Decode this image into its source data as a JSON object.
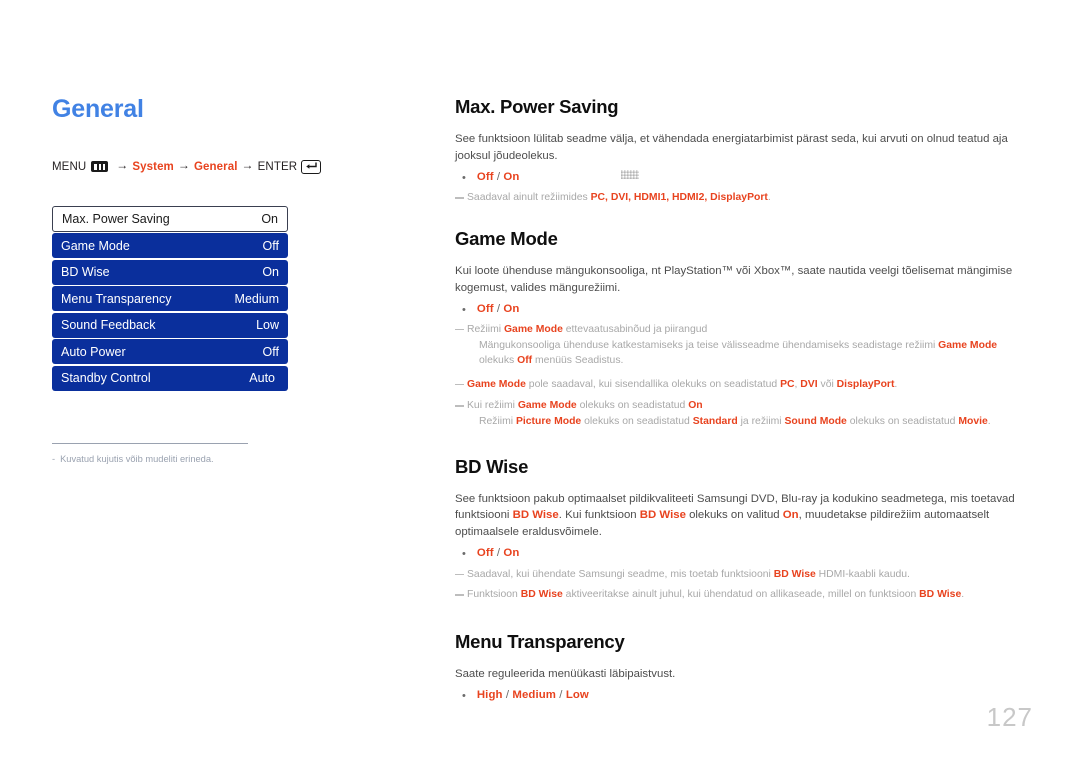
{
  "page": {
    "section_title": "General",
    "page_number": "127"
  },
  "breadcrumb": {
    "menu_label": "MENU",
    "menu_icon": "menu-bars-icon",
    "arrow": "→",
    "step1": "System",
    "step2": "General",
    "enter_label": "ENTER",
    "enter_icon": "enter-return-icon"
  },
  "osd_menu": {
    "rows": [
      {
        "label": "Max. Power Saving",
        "value": "On",
        "selected": true
      },
      {
        "label": "Game Mode",
        "value": "Off",
        "selected": false
      },
      {
        "label": "BD Wise",
        "value": "On",
        "selected": false
      },
      {
        "label": "Menu Transparency",
        "value": "Medium",
        "selected": false
      },
      {
        "label": "Sound Feedback",
        "value": "Low",
        "selected": false
      },
      {
        "label": "Auto Power",
        "value": "Off",
        "selected": false
      },
      {
        "label": "Standby Control",
        "value": "Auto",
        "selected": false
      }
    ]
  },
  "left_note": {
    "dash": "-",
    "text": "Kuvatud kujutis võib mudeliti erineda."
  },
  "topics": {
    "max_power_saving": {
      "title": "Max. Power Saving",
      "body": "See funktsioon lülitab seadme välja, et vähendada energiatarbimist pärast seda, kui arvuti on olnud teatud aja jooksul jõudeolekus.",
      "options": "Off / On",
      "note1_prefix": "Saadaval ainult režiimides ",
      "note1_modes": "PC, DVI, HDMI1, HDMI2, DisplayPort",
      "note1_suffix": "."
    },
    "game_mode": {
      "title": "Game Mode",
      "body": "Kui loote ühenduse mängukonsooliga, nt PlayStation™ või Xbox™, saate nautida veelgi tõelisemat mängimise kogemust, valides mängurežiimi.",
      "options": "Off / On",
      "note1_a": "Režiimi ",
      "note1_b": "Game Mode",
      "note1_c": " ettevaatusabinõud ja piirangud",
      "note1_sub_a": "Mängukonsooliga ühenduse katkestamiseks ja teise välisseadme ühendamiseks seadistage režiimi ",
      "note1_sub_b": "Game Mode",
      "note1_sub_c": " olekuks ",
      "note1_sub_d": "Off",
      "note1_sub_e": " menüüs Seadistus.",
      "note2_a": "Game Mode",
      "note2_b": " pole saadaval, kui sisendallika olekuks on seadistatud ",
      "note2_c": "PC",
      "note2_d": ", ",
      "note2_e": "DVI",
      "note2_f": " või ",
      "note2_g": "DisplayPort",
      "note2_h": ".",
      "note3_a": "Kui režiimi ",
      "note3_b": "Game Mode",
      "note3_c": " olekuks on seadistatud ",
      "note3_d": "On",
      "note3_sub_a": "Režiimi ",
      "note3_sub_b": "Picture Mode",
      "note3_sub_c": " olekuks on seadistatud ",
      "note3_sub_d": "Standard",
      "note3_sub_e": " ja režiimi ",
      "note3_sub_f": "Sound Mode",
      "note3_sub_g": " olekuks on seadistatud ",
      "note3_sub_h": "Movie",
      "note3_sub_i": "."
    },
    "bd_wise": {
      "title": "BD Wise",
      "body_a": "See funktsioon pakub optimaalset pildikvaliteeti Samsungi DVD, Blu-ray ja kodukino seadmetega, mis toetavad funktsiooni ",
      "body_b": "BD Wise",
      "body_c": ". Kui funktsioon ",
      "body_d": "BD Wise",
      "body_e": " olekuks on valitud ",
      "body_f": "On",
      "body_g": ", muudetakse pildirežiim automaatselt optimaalsele eraldusvõimele.",
      "options": "Off / On",
      "note1_a": "Saadaval, kui ühendate Samsungi seadme, mis toetab funktsiooni ",
      "note1_b": "BD Wise",
      "note1_c": " HDMI-kaabli kaudu.",
      "note2_a": "Funktsioon ",
      "note2_b": "BD Wise",
      "note2_c": " aktiveeritakse ainult juhul, kui ühendatud on allikaseade, millel on funktsioon ",
      "note2_d": "BD Wise",
      "note2_e": "."
    },
    "menu_transparency": {
      "title": "Menu Transparency",
      "body": "Saate reguleerida menüükasti läbipaistvust.",
      "options": "High / Medium / Low"
    }
  },
  "colors": {
    "title_blue": "#4182e4",
    "accent_red": "#e8431f",
    "osd_blue": "#0a2f9c",
    "note_gray": "#a8a8a8",
    "page_number_gray": "#c8c8c8"
  }
}
